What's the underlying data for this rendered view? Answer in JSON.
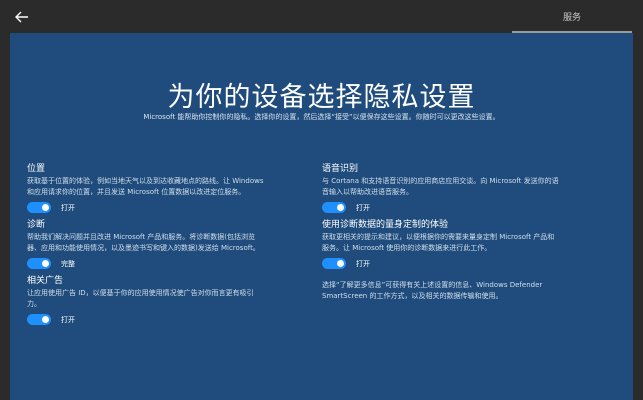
{
  "topbar": {
    "services_tab": "服务"
  },
  "header": {
    "title": "为你的设备选择隐私设置",
    "subtitle": "Microsoft 能帮助你控制你的隐私。选择你的设置，然后选择“接受”以便保存这些设置。你随时可以更改这些设置。"
  },
  "left": {
    "location": {
      "title": "位置",
      "desc": "获取基于位置的体验，例如当地天气以及到达收藏地点的路线。让 Windows\n和应用请求你的位置，并且发送 Microsoft 位置数据以改进定位服务。",
      "state": "打开"
    },
    "diagnostics": {
      "title": "诊断",
      "desc": "帮助我们解决问题并且改进 Microsoft 产品和服务。将诊断数据(包括浏览\n器、应用和功能使用情况，以及墨迹书写和键入的数据)发送给 Microsoft。",
      "state": "完整"
    },
    "ads": {
      "title": "相关广告",
      "desc": "让应用使用广告 ID，以便基于你的应用使用情况使广告对你而言更有吸引\n力。",
      "state": "打开"
    }
  },
  "right": {
    "speech": {
      "title": "语音识别",
      "desc": "与 Cortana 和支持语音识别的应用商店应用交谈。向 Microsoft 发送你的语\n音输入以帮助改进语音服务。",
      "state": "打开"
    },
    "tailored": {
      "title": "使用诊断数据的量身定制的体验",
      "desc": "获取更相关的提示和建议，以便根据你的需要来量身定制 Microsoft 产品和\n服务。让 Microsoft 使用你的诊断数据来进行此工作。",
      "state": "打开"
    },
    "note": "选择“了解更多信息”可获得有关上述设置的信息、Windows Defender\nSmartScreen 的工作方式，以及相关的数据传输和使用。"
  },
  "colors": {
    "panel": "#1f4c7c",
    "toggle_on": "#1e90ff",
    "chrome": "#2b2b2b"
  },
  "icons": {
    "back": "back-arrow-icon"
  }
}
